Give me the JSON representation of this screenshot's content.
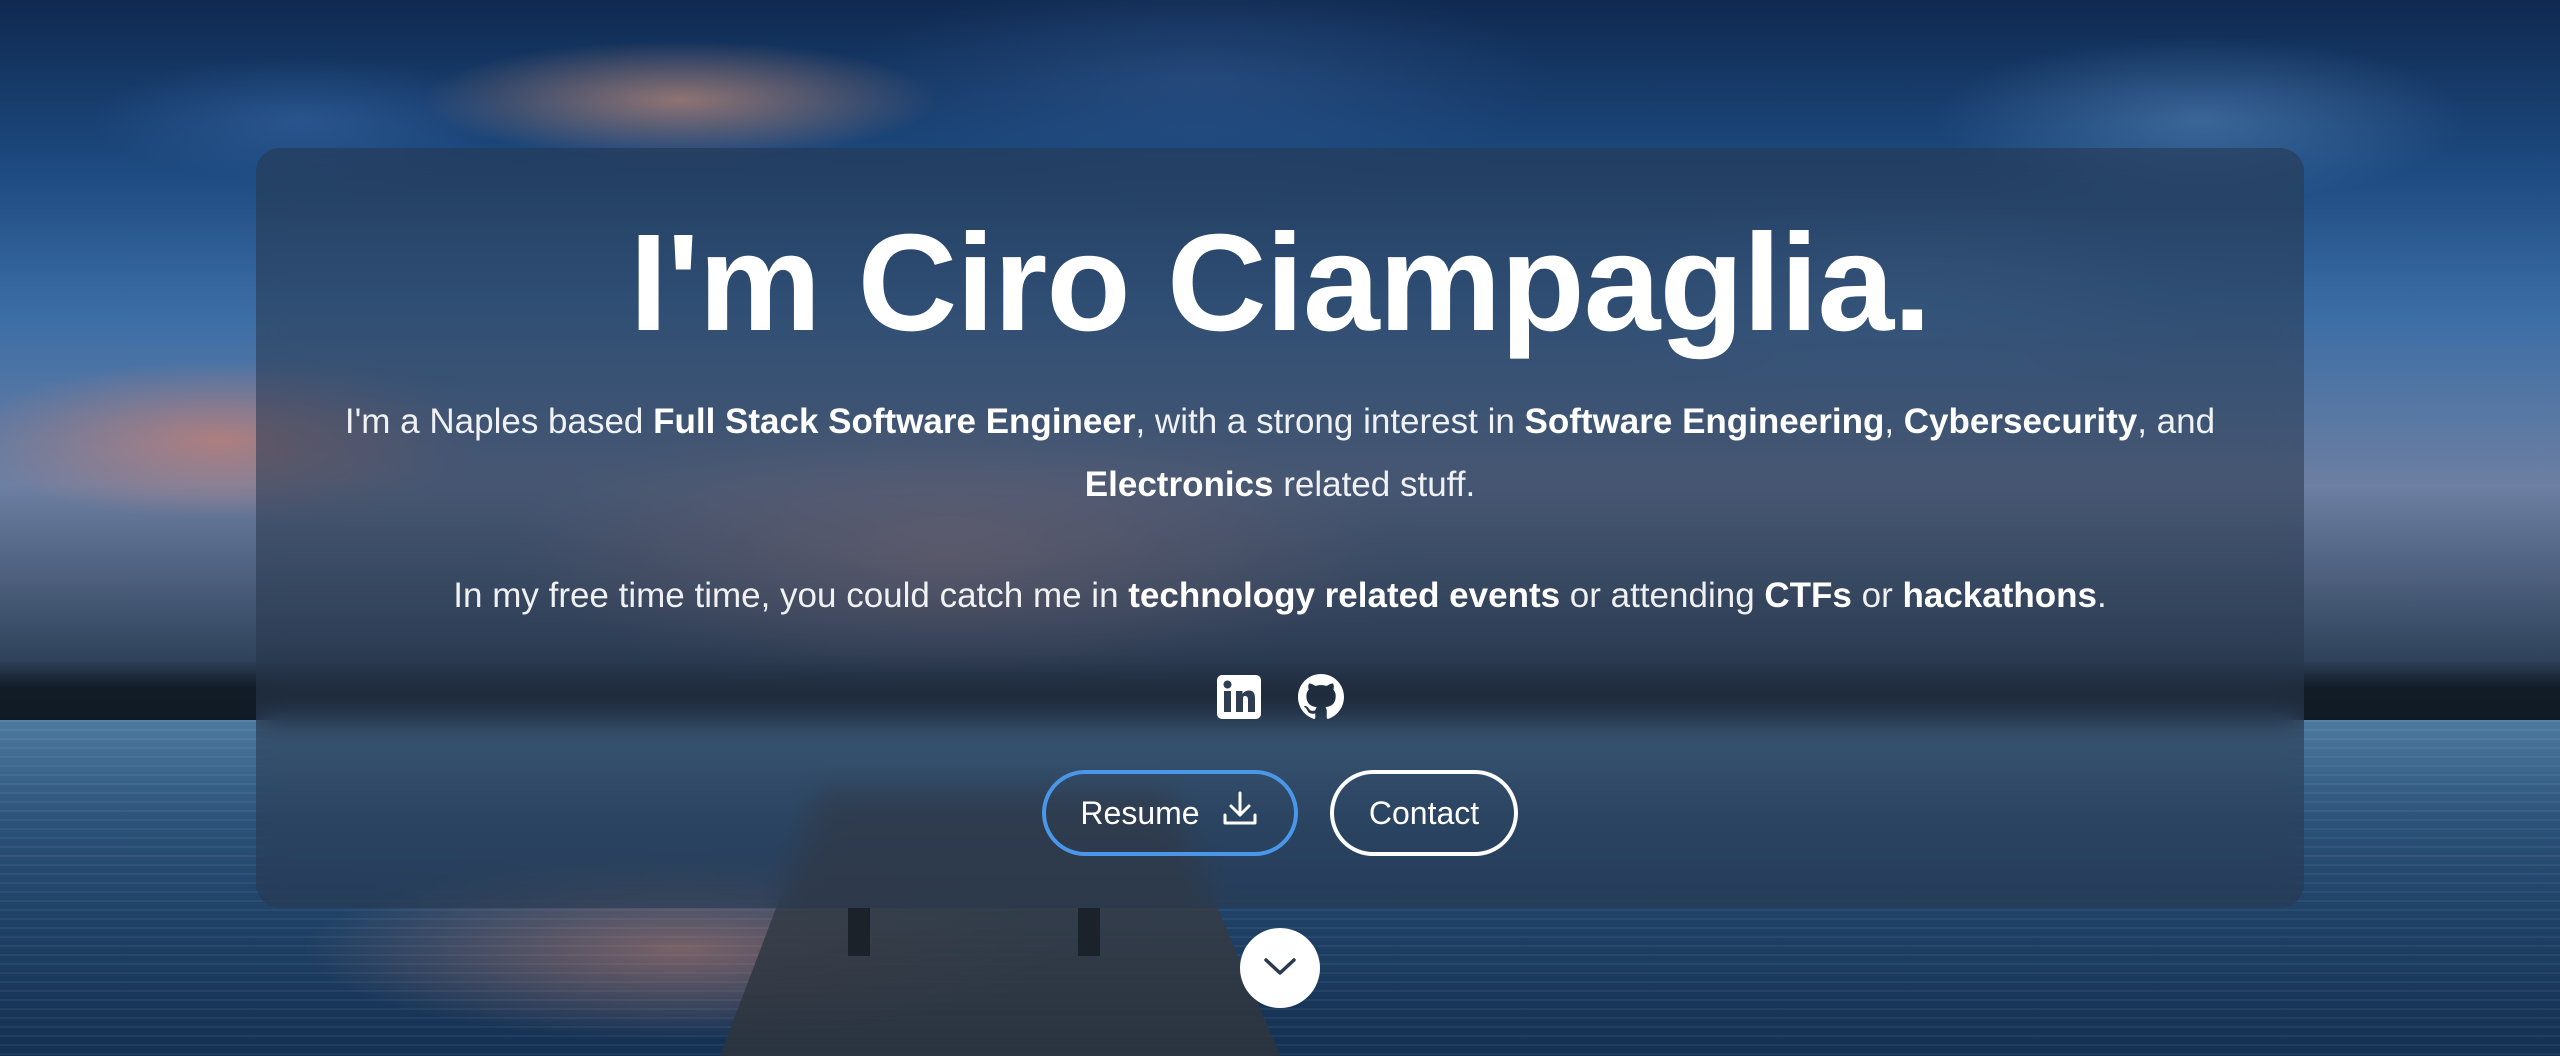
{
  "hero": {
    "title": "I'm Ciro Ciampaglia.",
    "intro": {
      "t1": "I'm a Naples based ",
      "b1": "Full Stack Software Engineer",
      "t2": ", with a strong interest in ",
      "b2": "Software Engineering",
      "t3": ", ",
      "b3": "Cybersecurity",
      "t4": ", and ",
      "b4": "Electronics",
      "t5": " related stuff."
    },
    "free_time": {
      "t1": "In my free time time, you could catch me in ",
      "b1": "technology related events",
      "t2": " or attending ",
      "b2": "CTFs",
      "t3": " or ",
      "b3": "hackathons",
      "t4": "."
    }
  },
  "social": {
    "icons": [
      "linkedin-icon",
      "github-icon"
    ]
  },
  "buttons": {
    "resume_label": "Resume",
    "resume_icon": "download-icon",
    "contact_label": "Contact"
  },
  "scroll": {
    "icon": "chevron-down-icon"
  },
  "colors": {
    "resume_border": "#4a97ea",
    "panel_bg": "rgba(40,54,76,0.55)",
    "text": "#ffffff"
  }
}
